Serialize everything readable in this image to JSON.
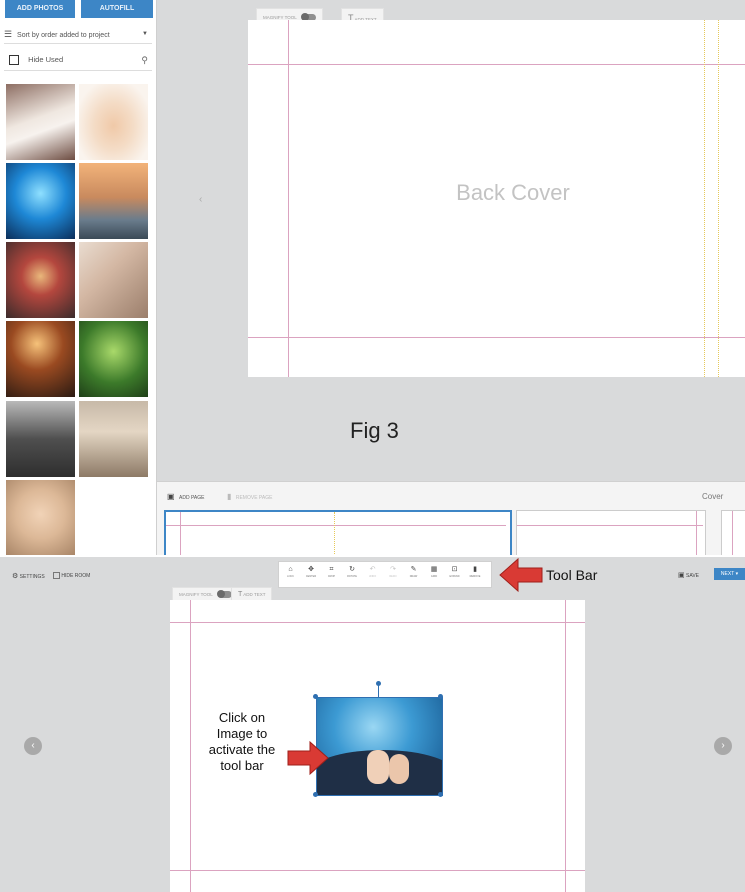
{
  "top": {
    "sidebar": {
      "add_photos": "ADD PHOTOS",
      "autofill": "AUTOFILL",
      "sort_label": "Sort by order added to project",
      "hide_used": "Hide Used"
    },
    "tabs": {
      "magnify": "MAGNIFY TOOL",
      "add_text": "ADD TEXT"
    },
    "back_cover": "Back Cover",
    "caption": "Fig 3",
    "strip": {
      "add_page": "ADD PAGE",
      "remove_page": "REMOVE PAGE",
      "cover": "Cover"
    }
  },
  "bottom": {
    "settings": "SETTINGS",
    "hide_room": "HIDE ROOM",
    "save": "SAVE",
    "next": "NEXT",
    "toolbar_items": [
      {
        "label": "LOCK",
        "icon": "lock-icon",
        "glyph": "⌂"
      },
      {
        "label": "CENTER",
        "icon": "move-icon",
        "glyph": "✥"
      },
      {
        "label": "CROP",
        "icon": "crop-icon",
        "glyph": "⌗"
      },
      {
        "label": "ROTATE",
        "icon": "rotate-icon",
        "glyph": "↻"
      },
      {
        "label": "UNDO",
        "icon": "undo-icon",
        "glyph": "↶",
        "disabled": true
      },
      {
        "label": "REDO",
        "icon": "redo-icon",
        "glyph": "↷",
        "disabled": true
      },
      {
        "label": "DRAW",
        "icon": "draw-icon",
        "glyph": "✎"
      },
      {
        "label": "GRID",
        "icon": "grid-icon",
        "glyph": "▦"
      },
      {
        "label": "EXPAND",
        "icon": "expand-icon",
        "glyph": "⊡"
      },
      {
        "label": "REMOVE",
        "icon": "trash-icon",
        "glyph": "▮"
      }
    ],
    "tabs": {
      "magnify": "MAGNIFY TOOL",
      "add_text": "ADD TEXT"
    }
  },
  "annotations": {
    "tool_bar": "Tool Bar",
    "click_note": "Click on Image to activate the tool bar"
  },
  "colors": {
    "accent_blue": "#3d86c6",
    "guide_pink": "#dba3c0",
    "arrow_red": "#d93a34"
  }
}
